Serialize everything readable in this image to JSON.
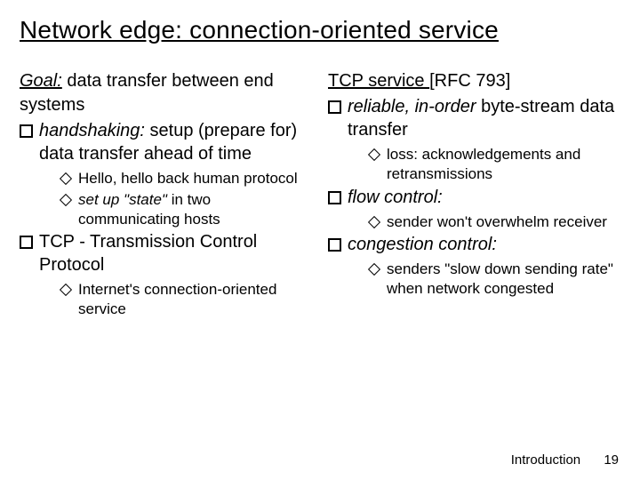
{
  "title": "Network edge: connection-oriented service",
  "left": {
    "goal_label": "Goal:",
    "goal_rest": " data transfer between end systems",
    "b1a": "handshaking:",
    "b1b": " setup (prepare for) data transfer ahead of time",
    "b1s1": "Hello, hello back human protocol",
    "b1s2a": "set up \"state\"",
    "b1s2b": " in two communicating hosts",
    "b2": "TCP - Transmission Control Protocol",
    "b2s1": "Internet's connection-oriented service"
  },
  "right": {
    "hdr_a": "TCP service ",
    "hdr_b": "[RFC 793]",
    "r1a": "reliable, in-order",
    "r1b": " byte-stream data transfer",
    "r1s1": "loss: acknowledgements and retransmissions",
    "r2": "flow control:",
    "r2s1": "sender won't overwhelm receiver",
    "r3": "congestion control:",
    "r3s1": "senders \"slow down sending rate\" when network congested"
  },
  "footer": {
    "label": "Introduction",
    "page": "19"
  }
}
